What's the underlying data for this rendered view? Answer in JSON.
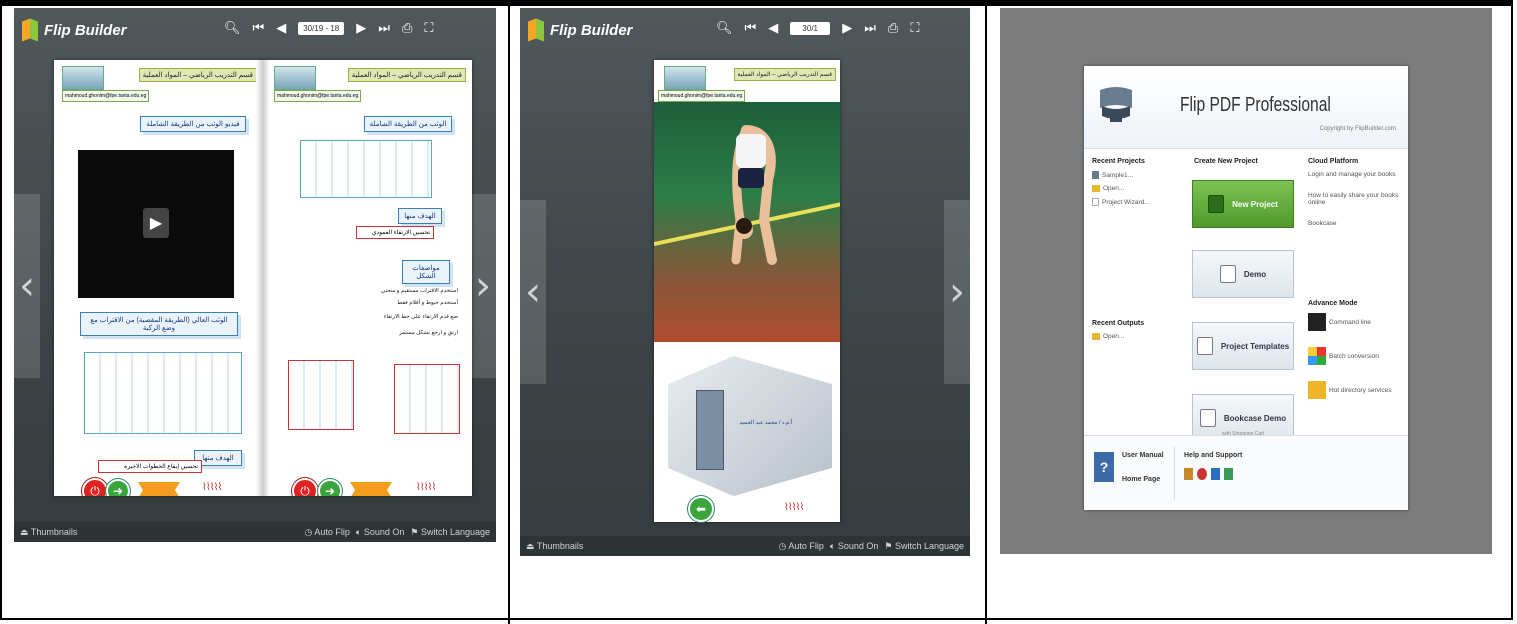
{
  "viewer_left": {
    "brand": "Flip Builder",
    "page_indicator": "30/19 - 18",
    "bottom": {
      "thumbnails": "Thumbnails",
      "auto_flip": "Auto Flip",
      "sound": "Sound On",
      "language": "Switch Language"
    },
    "left_page": {
      "header": "قسم التدريب الرياضي – المواد العملية",
      "email": "mahmoud.ghonim@fpe.tanta.edu.eg",
      "video_title": "فيديو الوثب من الطريقة الشاملة",
      "caption": "الوثب العالي (الطريقة المقصية) من الاقتراب مع وضع الركبة",
      "goal_label": "الهدف منها",
      "goal_text": "تحسين إيقاع الخطوات الاخيرة"
    },
    "right_page": {
      "header": "قسم التدريب الرياضي – المواد العملية",
      "email": "mahmoud.ghonim@fpe.tanta.edu.eg",
      "title": "الوثب من الطريقة الشاملة",
      "goal_label": "الهدف منها",
      "goal_text": "تحسين الارتقاء العمودي",
      "section": "مواصفات الشكل",
      "bullets": [
        "استخدم الاقتراب مستقيم و منحني",
        "أستخدم خيوط و أقلام فقط",
        "ضع قدم الارتقاء على خط الارتقاء",
        "ارتقِ و ارجع بشكل مستمر"
      ]
    }
  },
  "viewer_middle": {
    "brand": "Flip Builder",
    "page_indicator": "30/1",
    "header": "قسم التدريب الرياضي – المواد العملية",
    "email": "mahmoud.ghonim@fpe.tanta.edu.eg",
    "cube_text": "أ.م.د / محمد عبد الحميد",
    "bottom": {
      "thumbnails": "Thumbnails",
      "auto_flip": "Auto Flip",
      "sound": "Sound On",
      "language": "Switch Language"
    }
  },
  "flip_pdf": {
    "title": "Flip PDF Professional",
    "copyright": "Copyright by FlipBuilder.com",
    "recent_projects": {
      "heading": "Recent Projects",
      "items": [
        "Sample1...",
        "Open...",
        "Project Wizard..."
      ]
    },
    "create_new": {
      "heading": "Create New Project",
      "new_project": "New Project",
      "demo": "Demo",
      "templates": "Project Templates",
      "bookcase_demo": "Bookcase Demo",
      "bookcase_sub": "with Shopping Cart"
    },
    "cloud": {
      "heading": "Cloud Platform",
      "items": [
        "Login and manage your books",
        "How to easily share your books online",
        "Bookcase"
      ]
    },
    "advance": {
      "heading": "Advance Mode",
      "items": [
        "Command line",
        "Batch conversion",
        "Hot directory services"
      ]
    },
    "recent_outputs": {
      "heading": "Recent Outputs",
      "items": [
        "Open..."
      ]
    },
    "footer": {
      "user_manual": "User Manual",
      "home_page": "Home Page",
      "help": "Help and Support"
    }
  }
}
